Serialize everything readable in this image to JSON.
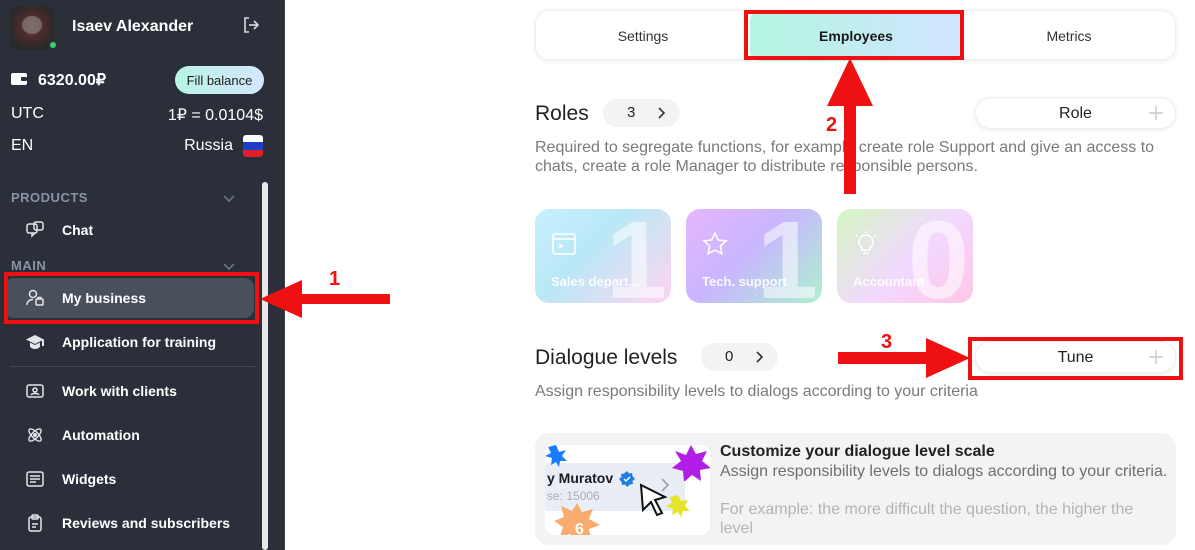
{
  "user": {
    "name": "Isaev Alexander",
    "status": "online"
  },
  "balance": {
    "amount": "6320.00₽",
    "fill_label": "Fill balance"
  },
  "timezone": {
    "label": "UTC",
    "rate": "1₽ = 0.0104$"
  },
  "language": {
    "label": "EN",
    "country": "Russia"
  },
  "sidebar": {
    "products_title": "PRODUCTS",
    "main_title": "MAIN",
    "items": [
      {
        "label": "Chat",
        "icon": "chat-icon"
      },
      {
        "label": "My business",
        "icon": "business-user-icon",
        "active": true
      },
      {
        "label": "Application for training",
        "icon": "graduation-cap-icon"
      },
      {
        "label": "Work with clients",
        "icon": "contact-card-icon"
      },
      {
        "label": "Automation",
        "icon": "atom-icon"
      },
      {
        "label": "Widgets",
        "icon": "widget-list-icon"
      },
      {
        "label": "Reviews and subscribers",
        "icon": "clipboard-icon"
      }
    ]
  },
  "tabs": [
    {
      "label": "Settings"
    },
    {
      "label": "Employees",
      "active": true
    },
    {
      "label": "Metrics"
    }
  ],
  "roles": {
    "title": "Roles",
    "count": "3",
    "button": "Role",
    "description": "Required to segregate functions, for example create role Support and give an access to chats, create a role Manager to distribute responsible persons.",
    "cards": [
      {
        "name": "Sales depart...",
        "count": "1",
        "icon": "terminal-window-icon"
      },
      {
        "name": "Tech. support",
        "count": "1",
        "icon": "star-icon"
      },
      {
        "name": "Accountant",
        "count": "0",
        "icon": "lightbulb-icon"
      }
    ]
  },
  "dialogue_levels": {
    "title": "Dialogue levels",
    "count": "0",
    "button": "Tune",
    "description": "Assign responsibility levels to dialogs according to your criteria"
  },
  "promo": {
    "title": "Customize your dialogue level scale",
    "text": "Assign responsibility levels to dialogs according to your criteria.",
    "example": "For example: the more difficult the question, the higher the level",
    "preview_name": "y Muratov",
    "preview_sub": "se: 15006",
    "preview_badge": "6"
  },
  "annotations": {
    "one": "1",
    "two": "2",
    "three": "3",
    "color": "#ef1111"
  },
  "colors": {
    "sidebar_bg": "#2b2f3a",
    "accent_gradient_start": "#b4f6e2",
    "accent_gradient_end": "#d0e4ff"
  }
}
